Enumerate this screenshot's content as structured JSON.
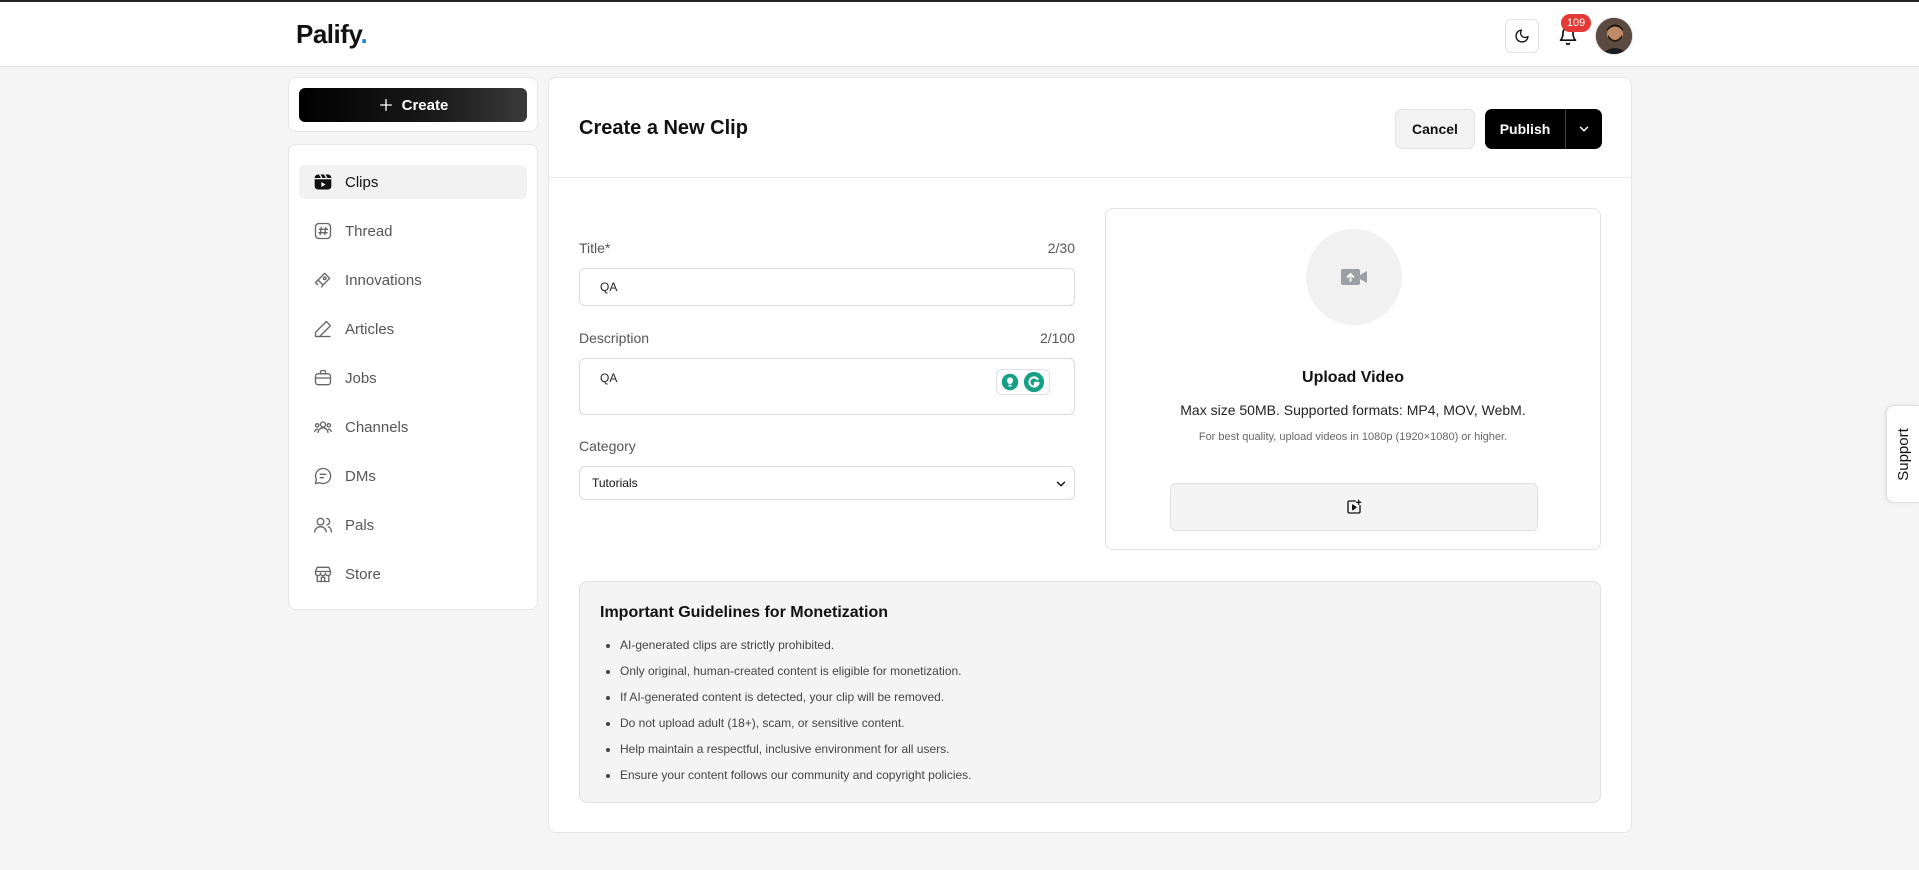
{
  "header": {
    "logo_text": "Palify",
    "logo_dot": ".",
    "notification_count": "109"
  },
  "sidebar": {
    "create_label": "Create",
    "items": [
      {
        "label": "Clips",
        "icon": "clips-icon",
        "active": true
      },
      {
        "label": "Thread",
        "icon": "hash-icon"
      },
      {
        "label": "Innovations",
        "icon": "innovations-icon"
      },
      {
        "label": "Articles",
        "icon": "pencil-icon"
      },
      {
        "label": "Jobs",
        "icon": "briefcase-icon"
      },
      {
        "label": "Channels",
        "icon": "users-icon"
      },
      {
        "label": "DMs",
        "icon": "chat-icon"
      },
      {
        "label": "Pals",
        "icon": "pals-icon"
      },
      {
        "label": "Store",
        "icon": "store-icon"
      }
    ]
  },
  "main": {
    "title": "Create a New Clip",
    "cancel_label": "Cancel",
    "publish_label": "Publish",
    "form": {
      "title_label": "Title*",
      "title_count": "2/30",
      "title_value": "QA",
      "description_label": "Description",
      "description_count": "2/100",
      "description_value": "QA",
      "category_label": "Category",
      "category_value": "Tutorials"
    },
    "upload": {
      "title": "Upload Video",
      "subtitle": "Max size 50MB. Supported formats: MP4, MOV, WebM.",
      "hint": "For best quality, upload videos in 1080p (1920×1080) or higher."
    },
    "guidelines": {
      "title": "Important Guidelines for Monetization",
      "items": [
        "AI-generated clips are strictly prohibited.",
        "Only original, human-created content is eligible for monetization.",
        "If AI-generated content is detected, your clip will be removed.",
        "Do not upload adult (18+), scam, or sensitive content.",
        "Help maintain a respectful, inclusive environment for all users.",
        "Ensure your content follows our community and copyright policies."
      ]
    }
  },
  "support_label": "Support",
  "colors": {
    "accent": "#000000",
    "logo_dot": "#1e88e5",
    "badge": "#e53935"
  }
}
